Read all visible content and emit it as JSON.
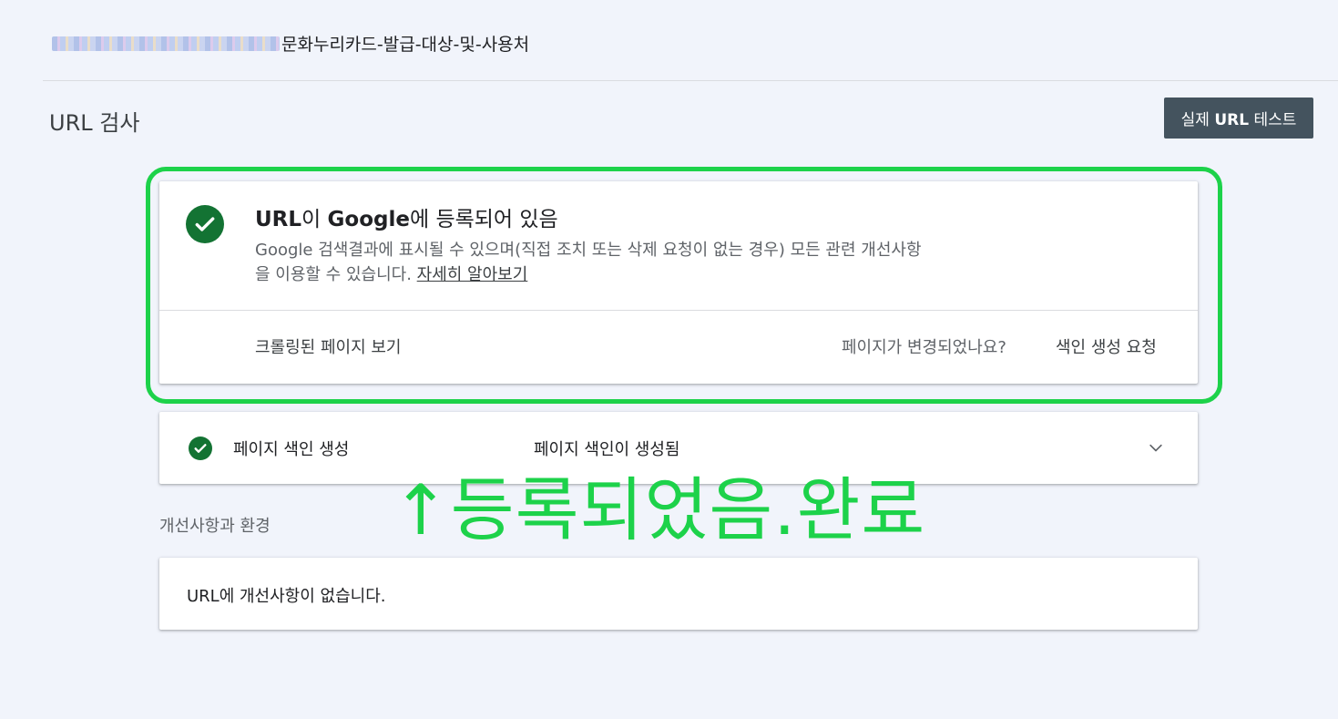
{
  "header": {
    "url_path": "문화누리카드-발급-대상-및-사용처",
    "page_title": "URL 검사",
    "live_test_prefix": "실제 ",
    "live_test_bold": "URL",
    "live_test_suffix": " 테스트"
  },
  "status_card": {
    "title_part1": "URL",
    "title_part2": "이 ",
    "title_part3": "Google",
    "title_part4": "에 등록되어 있음",
    "description": "Google 검색결과에 표시될 수 있으며(직접 조치 또는 삭제 요청이 없는 경우) 모든 관련 개선사항을 이용할 수 있습니다. ",
    "learn_more": "자세히 알아보기",
    "view_crawled": "크롤링된 페이지 보기",
    "page_changed_question": "페이지가 변경되었나요?",
    "request_indexing": "색인 생성 요청"
  },
  "indexing_card": {
    "label": "페이지 색인 생성",
    "status": "페이지 색인이 생성됨"
  },
  "annotation": "↑등록되었음.완료",
  "enhancements": {
    "section_label": "개선사항과 환경",
    "message": "URL에 개선사항이 없습니다."
  },
  "colors": {
    "highlight": "#1dd24a",
    "success_green": "#137333",
    "button_bg": "#44535e",
    "page_bg": "#f1f4fb"
  },
  "icons": {
    "status": "check-circle-icon",
    "expand": "chevron-down-icon"
  }
}
